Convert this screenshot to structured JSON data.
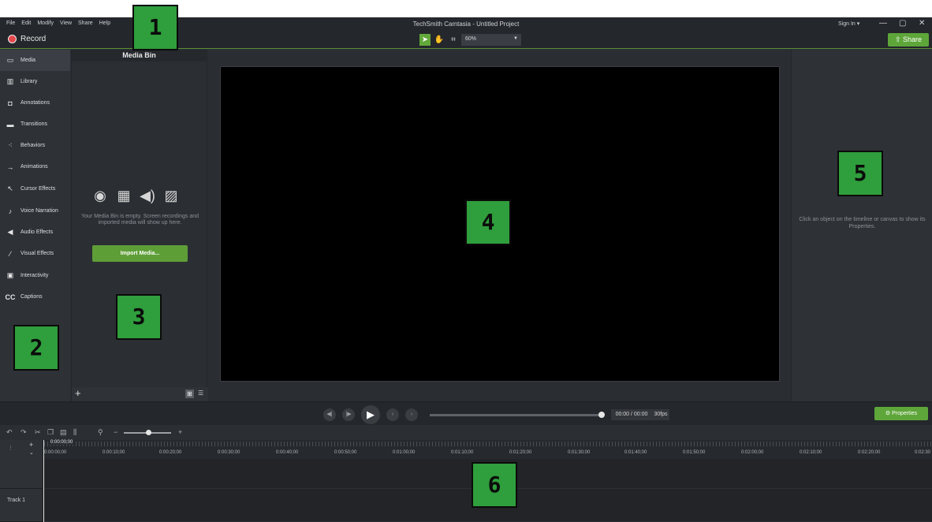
{
  "window": {
    "title": "TechSmith Camtasia - Untitled Project",
    "menu": [
      "File",
      "Edit",
      "Modify",
      "View",
      "Share",
      "Help"
    ],
    "sign_in": "Sign In ▾",
    "minimize": "—",
    "restore": "▢",
    "close": "✕"
  },
  "toolbar": {
    "record_label": "Record",
    "zoom_value": "60%",
    "share_label": "Share",
    "tools": [
      "select-arrow",
      "pan-hand",
      "crop"
    ]
  },
  "sidebar": {
    "items": [
      {
        "label": "Media",
        "icon": "film-strip-icon",
        "glyph": "▭",
        "active": true
      },
      {
        "label": "Library",
        "icon": "books-icon",
        "glyph": "▥"
      },
      {
        "label": "Annotations",
        "icon": "callout-icon",
        "glyph": "◘"
      },
      {
        "label": "Transitions",
        "icon": "transition-icon",
        "glyph": "▬"
      },
      {
        "label": "Behaviors",
        "icon": "behaviors-icon",
        "glyph": "⁖"
      },
      {
        "label": "Animations",
        "icon": "arrow-icon",
        "glyph": "→"
      },
      {
        "label": "Cursor Effects",
        "icon": "cursor-icon",
        "glyph": "↖"
      },
      {
        "label": "Voice Narration",
        "icon": "microphone-icon",
        "glyph": "♪"
      },
      {
        "label": "Audio Effects",
        "icon": "speaker-icon",
        "glyph": "◀"
      },
      {
        "label": "Visual Effects",
        "icon": "magic-wand-icon",
        "glyph": "⁄"
      },
      {
        "label": "Interactivity",
        "icon": "interactivity-icon",
        "glyph": "▣"
      },
      {
        "label": "Captions",
        "icon": "cc-icon",
        "glyph": "CC"
      }
    ]
  },
  "media_bin": {
    "title": "Media Bin",
    "empty_text": "Your Media Bin is empty. Screen recordings and imported media will show up here.",
    "import_label": "Import Media...",
    "add": "+"
  },
  "properties_panel": {
    "hint": "Click an object on the timeline or canvas to show its Properties."
  },
  "playback": {
    "timecode": "00:00 / 00:00",
    "fps": "30fps",
    "properties_label": "Properties",
    "progress": 1.0
  },
  "timeline": {
    "playhead_time": "0:00:00;00",
    "ruler_labels": [
      "0:00:00;00",
      "0:00:10;00",
      "0:00:20;00",
      "0:00:30;00",
      "0:00:40;00",
      "0:00:50;00",
      "0:01:00;00",
      "0:01:10;00",
      "0:01:20;00",
      "0:01:30;00",
      "0:01:40;00",
      "0:01:50;00",
      "0:02:00;00",
      "0:02:10;00",
      "0:02:20;00",
      "0:02:30"
    ],
    "track_label": "Track 1",
    "zoom_level": 0.5
  },
  "callouts": [
    "1",
    "2",
    "3",
    "4",
    "5",
    "6"
  ],
  "colors": {
    "accent_green": "#5ea63a",
    "record_red": "#e5484d",
    "callout_green": "#2f9e3c"
  }
}
